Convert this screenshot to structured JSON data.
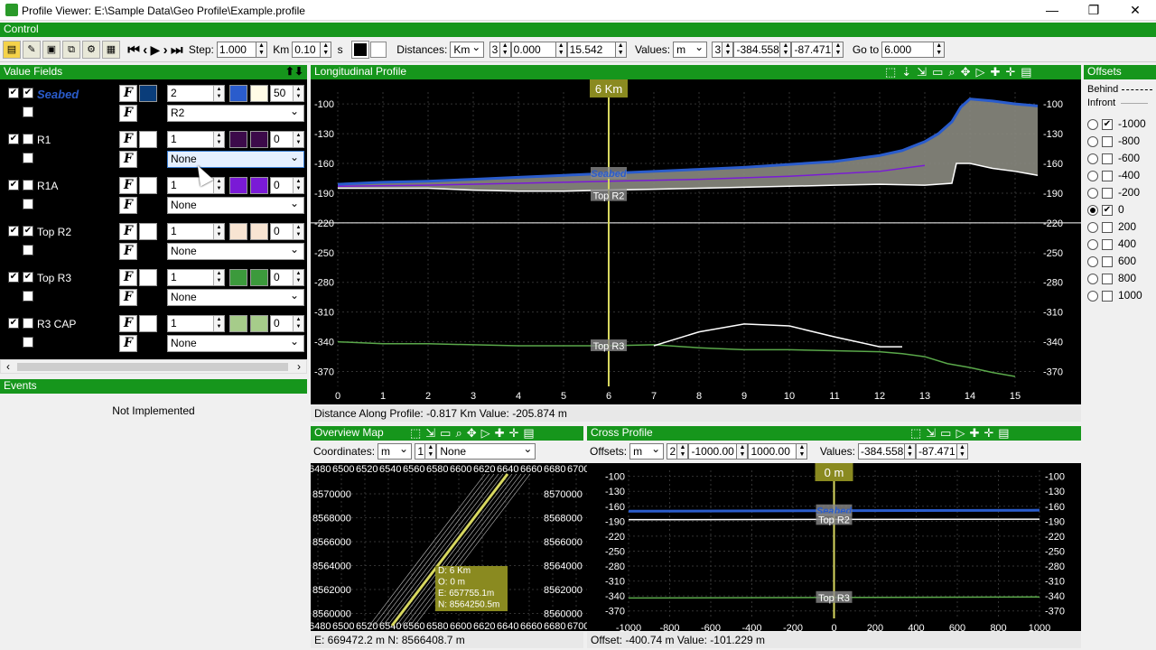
{
  "window": {
    "title": "Profile Viewer: E:\\Sample Data\\Geo Profile\\Example.profile",
    "minimize": "—",
    "restore": "❐",
    "close": "✕"
  },
  "control_header": "Control",
  "toolbar": {
    "step_label": "Step:",
    "step_value": "1.000",
    "step_unit": "Km",
    "speed_value": "0.10",
    "speed_unit": "s",
    "distances_label": "Distances:",
    "distances_unit": "Km",
    "distances_decimals": "3",
    "distances_from": "0.000",
    "distances_to": "15.542",
    "values_label": "Values:",
    "values_unit": "m",
    "values_decimals": "3",
    "values_from": "-384.558",
    "values_to": "-87.471",
    "goto_label": "Go to",
    "goto_value": "6.000"
  },
  "value_fields": {
    "header": "Value Fields",
    "rows": [
      {
        "name": "Seabed",
        "checked": "✔",
        "visible": "✔",
        "num": "2",
        "color1": "#0a3d7a",
        "color2": "#2a5ccc",
        "color3": "#fffbe6",
        "extra": "50",
        "ref": "R2"
      },
      {
        "name": "R1",
        "checked": "✔",
        "visible": "",
        "num": "1",
        "color1": "#ffffff",
        "color2": "#3c0a4a",
        "color3": "#3c0a4a",
        "extra": "0",
        "ref": "None"
      },
      {
        "name": "R1A",
        "checked": "✔",
        "visible": "",
        "num": "1",
        "color1": "#ffffff",
        "color2": "#7a1ad6",
        "color3": "#7a1ad6",
        "extra": "0",
        "ref": "None"
      },
      {
        "name": "Top R2",
        "checked": "✔",
        "visible": "✔",
        "num": "1",
        "color1": "#ffffff",
        "color2": "#f8e4d2",
        "color3": "#f8e4d2",
        "extra": "0",
        "ref": "None"
      },
      {
        "name": "Top R3",
        "checked": "✔",
        "visible": "✔",
        "num": "1",
        "color1": "#ffffff",
        "color2": "#3c9a3c",
        "color3": "#3c9a3c",
        "extra": "0",
        "ref": "None"
      },
      {
        "name": "R3 CAP",
        "checked": "✔",
        "visible": "",
        "num": "1",
        "color1": "#ffffff",
        "color2": "#a6cc8a",
        "color3": "#a6cc8a",
        "extra": "0",
        "ref": "None"
      }
    ]
  },
  "events": {
    "header": "Events",
    "message": "Not Implemented"
  },
  "longitudinal": {
    "header": "Longitudinal Profile",
    "cursor_label": "6 Km",
    "status": "Distance Along Profile: -0.817 Km  Value: -205.874 m",
    "layer_labels": {
      "seabed": "Seabed",
      "topr2": "Top R2",
      "topr3": "Top R3"
    }
  },
  "offsets": {
    "header": "Offsets",
    "behind": "Behind",
    "infront": "Infront",
    "items": [
      {
        "label": "-1000",
        "selected": false,
        "checked": true
      },
      {
        "label": "-800",
        "selected": false,
        "checked": false
      },
      {
        "label": "-600",
        "selected": false,
        "checked": false
      },
      {
        "label": "-400",
        "selected": false,
        "checked": false
      },
      {
        "label": "-200",
        "selected": false,
        "checked": false
      },
      {
        "label": "0",
        "selected": true,
        "checked": true
      },
      {
        "label": "200",
        "selected": false,
        "checked": false
      },
      {
        "label": "400",
        "selected": false,
        "checked": false
      },
      {
        "label": "600",
        "selected": false,
        "checked": false
      },
      {
        "label": "800",
        "selected": false,
        "checked": false
      },
      {
        "label": "1000",
        "selected": false,
        "checked": false
      }
    ]
  },
  "overview": {
    "header": "Overview Map",
    "coord_label": "Coordinates:",
    "coord_unit": "m",
    "coord_decimals": "1",
    "coord_system": "None",
    "tooltip": [
      "D: 6 Km",
      "O: 0 m",
      "E: 657755.1m",
      "N: 8564250.5m"
    ],
    "status": "E: 669472.2 m  N: 8566408.7 m"
  },
  "cross": {
    "header": "Cross Profile",
    "offsets_label": "Offsets:",
    "offsets_unit": "m",
    "offsets_decimals": "2",
    "offsets_from": "-1000.00",
    "offsets_to": "1000.00",
    "values_label": "Values:",
    "values_from": "-384.558",
    "values_to": "-87.471",
    "cursor_label": "0 m",
    "layer_labels": {
      "seabed": "Seabed",
      "topr2": "Top R2",
      "topr3": "Top R3"
    },
    "status": "Offset: -400.74 m  Value: -101.229 m"
  },
  "chart_data": [
    {
      "type": "line",
      "title": "Longitudinal Profile",
      "x_ticks": [
        0,
        1,
        2,
        3,
        4,
        5,
        6,
        7,
        8,
        9,
        10,
        11,
        12,
        13,
        14,
        15
      ],
      "y_ticks": [
        -100,
        -130,
        -160,
        -190,
        -220,
        -250,
        -280,
        -310,
        -340,
        -370
      ],
      "xlim": [
        0,
        15.5
      ],
      "ylim": [
        -385,
        -88
      ],
      "cursor_x": 6,
      "series": [
        {
          "name": "Seabed",
          "x": [
            0,
            1,
            2,
            3,
            4,
            5,
            6,
            7,
            8,
            9,
            10,
            11,
            12,
            12.5,
            13,
            13.3,
            13.6,
            13.8,
            14,
            14.5,
            15,
            15.5
          ],
          "y": [
            -181,
            -179,
            -178,
            -176,
            -174,
            -172,
            -170,
            -168,
            -166,
            -164,
            -161,
            -158,
            -152,
            -147,
            -138,
            -130,
            -118,
            -103,
            -95,
            -97,
            -100,
            -102
          ]
        },
        {
          "name": "Top R2",
          "x": [
            0,
            1,
            2,
            3,
            4,
            5,
            6,
            7,
            8,
            9,
            10,
            11,
            12,
            13,
            13.6,
            13.7,
            14,
            14.5,
            15,
            15.5
          ],
          "y": [
            -185,
            -185,
            -185,
            -187,
            -188,
            -188,
            -187,
            -186,
            -185,
            -184,
            -183,
            -182,
            -181,
            -182,
            -180,
            -160,
            -160,
            -165,
            -168,
            -172
          ]
        },
        {
          "name": "Top R3",
          "x": [
            0,
            1,
            2,
            3,
            4,
            5,
            6,
            7,
            8,
            9,
            10,
            11,
            12,
            12.5,
            13,
            13.5,
            14,
            14.5,
            15
          ],
          "y": [
            -340,
            -342,
            -342,
            -343,
            -344,
            -344,
            -344,
            -343,
            -346,
            -348,
            -348,
            -349,
            -350,
            -352,
            -355,
            -362,
            -366,
            -371,
            -375
          ]
        },
        {
          "name": "R1A",
          "x": [
            0,
            2,
            4,
            6,
            8,
            10,
            12,
            13
          ],
          "y": [
            -183,
            -182,
            -180,
            -178,
            -176,
            -173,
            -168,
            -162
          ]
        },
        {
          "name": "R3 CAP",
          "x": [
            7,
            8,
            9,
            10,
            11,
            12,
            12.5
          ],
          "y": [
            -344,
            -330,
            -322,
            -324,
            -335,
            -345,
            -345
          ]
        }
      ]
    },
    {
      "type": "line",
      "title": "Cross Profile",
      "x_ticks": [
        -1000,
        -800,
        -600,
        -400,
        -200,
        0,
        200,
        400,
        600,
        800,
        1000
      ],
      "y_ticks": [
        -100,
        -130,
        -160,
        -190,
        -220,
        -250,
        -280,
        -310,
        -340,
        -370
      ],
      "xlim": [
        -1000,
        1000
      ],
      "ylim": [
        -385,
        -88
      ],
      "cursor_x": 0,
      "series": [
        {
          "name": "Seabed",
          "x": [
            -1000,
            1000
          ],
          "y": [
            -170,
            -168
          ]
        },
        {
          "name": "Top R2",
          "x": [
            -1000,
            1000
          ],
          "y": [
            -187,
            -186
          ]
        },
        {
          "name": "Top R3",
          "x": [
            -1000,
            1000
          ],
          "y": [
            -344,
            -342
          ]
        }
      ]
    },
    {
      "type": "scatter",
      "title": "Overview Map",
      "x_ticks": [
        6480,
        6500,
        6520,
        6540,
        6560,
        6580,
        6600,
        6620,
        6640,
        6660,
        6680,
        6700
      ],
      "y_ticks": [
        8570000,
        8568000,
        8566000,
        8564000,
        8562000,
        8560000
      ]
    }
  ]
}
